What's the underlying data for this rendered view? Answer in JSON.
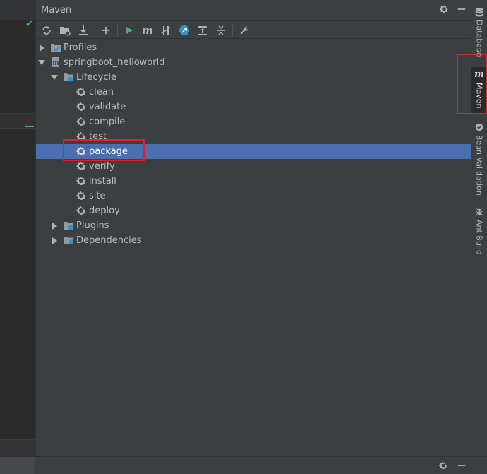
{
  "panel": {
    "title": "Maven",
    "settings_icon": "gear-icon",
    "minimize_icon": "minimize-icon"
  },
  "toolbar": [
    {
      "name": "reload-all-maven-projects",
      "icon": "refresh-icon"
    },
    {
      "name": "generate-sources",
      "icon": "folder-refresh-icon"
    },
    {
      "name": "download-sources",
      "icon": "download-icon"
    },
    {
      "name": "add-maven-project",
      "icon": "plus-icon"
    },
    {
      "name": "run-maven-build",
      "icon": "run-icon"
    },
    {
      "name": "execute-maven-goal",
      "icon": "maven-m-icon"
    },
    {
      "name": "toggle-offline-mode",
      "icon": "offline-icon"
    },
    {
      "name": "skip-tests",
      "icon": "skip-tests-icon"
    },
    {
      "name": "show-dependencies",
      "icon": "dependencies-icon"
    },
    {
      "name": "collapse-all",
      "icon": "collapse-icon"
    },
    {
      "name": "maven-settings",
      "icon": "wrench-icon"
    }
  ],
  "tree": {
    "profiles": "Profiles",
    "project": "springboot_helloworld",
    "lifecycle": "Lifecycle",
    "goals": [
      "clean",
      "validate",
      "compile",
      "test",
      "package",
      "verify",
      "install",
      "site",
      "deploy"
    ],
    "selected_goal": "package",
    "plugins": "Plugins",
    "dependencies": "Dependencies"
  },
  "right_tabs": [
    {
      "label": "Database",
      "icon": "database-icon"
    },
    {
      "label": "Maven",
      "icon": "maven-m-icon",
      "active": true
    },
    {
      "label": "Bean Validation",
      "icon": "bean-validation-icon"
    },
    {
      "label": "Ant Build",
      "icon": "ant-icon"
    }
  ],
  "colors": {
    "selection": "#4b6eaf",
    "highlight_box": "#e0202a",
    "run_green": "#59a869"
  }
}
